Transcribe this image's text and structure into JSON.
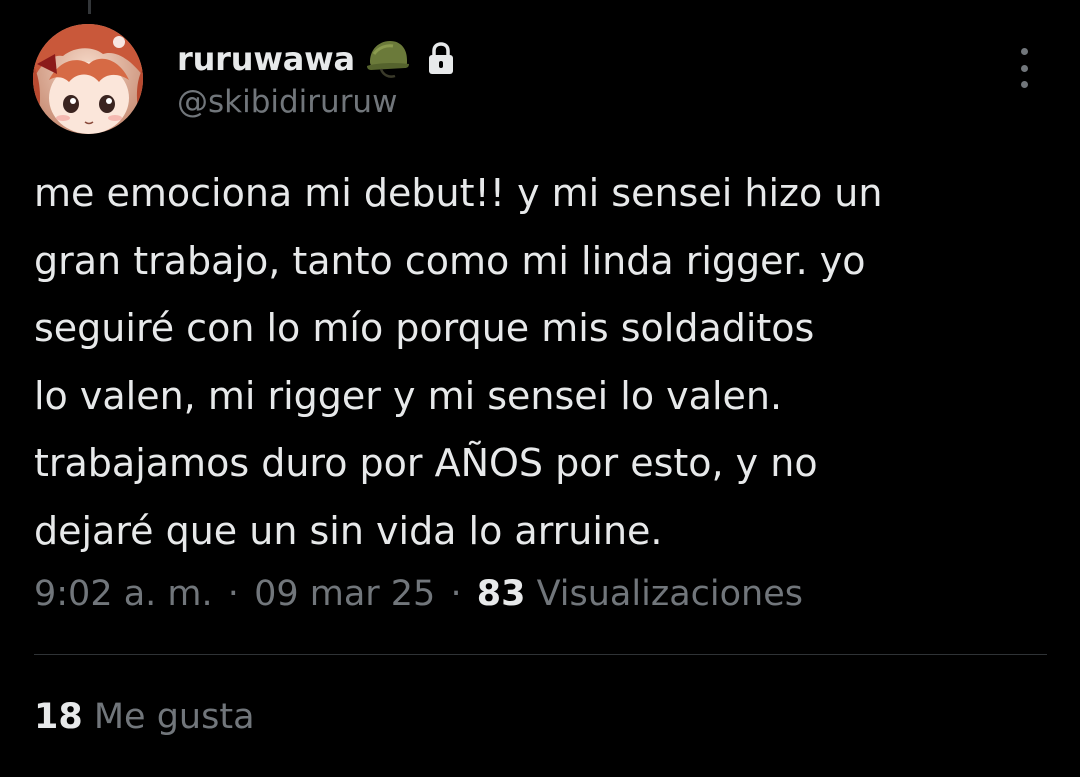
{
  "tweet": {
    "author": {
      "display_name": "ruruwawa",
      "name_emoji": "military-helmet-icon",
      "protected_icon": "lock-icon",
      "handle": "@skibidiruruw"
    },
    "text": "me emociona mi debut!! y mi sensei hizo un\ngran trabajo, tanto como mi linda rigger. yo\nseguiré con lo mío porque mis soldaditos\nlo valen, mi rigger y mi sensei lo valen.\ntrabajamos duro por AÑOS por esto, y no\ndejaré que un sin vida lo arruine.",
    "meta": {
      "time": "9:02 a. m.",
      "separator": "·",
      "date": "09 mar 25",
      "views_count": "83",
      "views_label": "Visualizaciones"
    },
    "likes": {
      "count": "18",
      "label": "Me gusta"
    }
  },
  "colors": {
    "background": "#000000",
    "primary_text": "#e7e9ea",
    "secondary_text": "#71767b",
    "divider": "#2f3336"
  }
}
